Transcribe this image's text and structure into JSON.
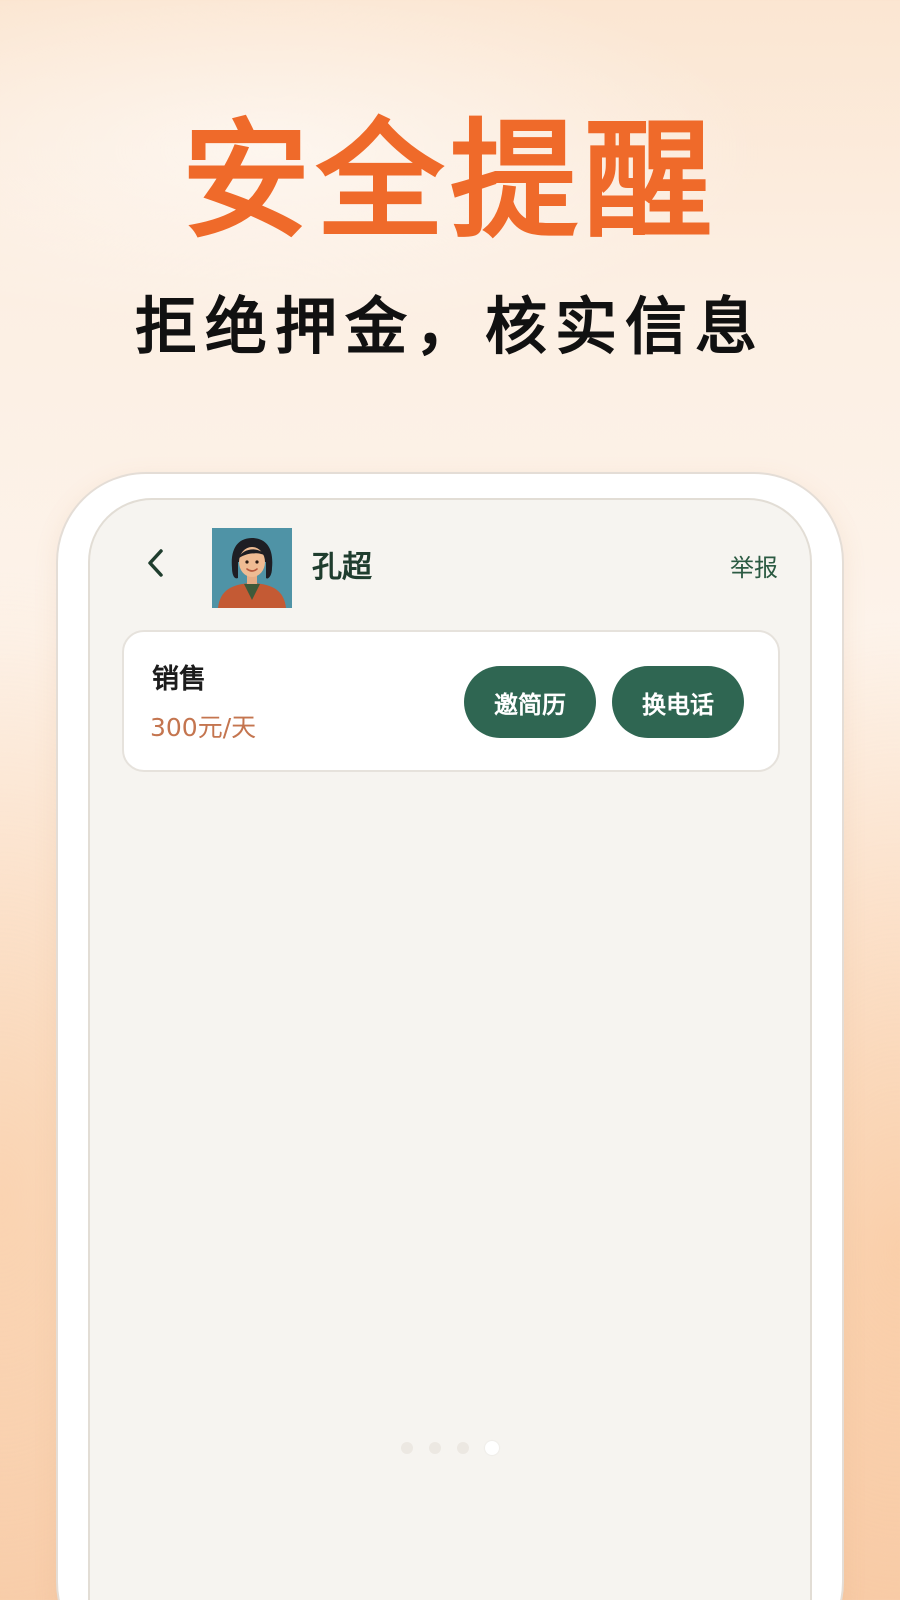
{
  "banner": {
    "headline": "安全提醒",
    "subline": "拒绝押金，核实信息"
  },
  "chat_header": {
    "back_icon": "chevron-left-icon",
    "contact_name": "孔超",
    "report_label": "举报"
  },
  "job_card": {
    "title": "销售",
    "salary": "300元/天",
    "invite_resume_label": "邀简历",
    "exchange_phone_label": "换电话"
  },
  "pager": {
    "total": 4,
    "active_index": 3
  },
  "colors": {
    "headline": "#ef6a2a",
    "primary_button": "#2f6652",
    "salary": "#c4754f",
    "name": "#1f3d2e"
  }
}
